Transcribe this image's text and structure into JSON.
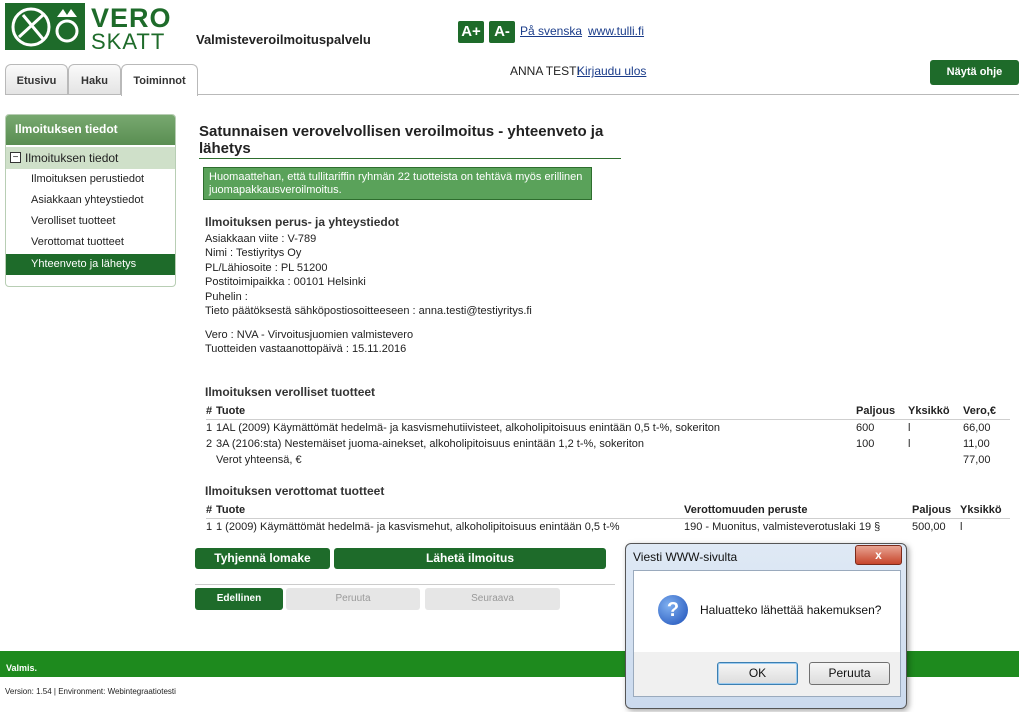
{
  "header": {
    "logo_text_1": "VERO",
    "logo_text_2": "SKATT",
    "service_title": "Valmisteveroilmoituspalvelu",
    "font_larger": "A+",
    "font_smaller": "A-",
    "language_link": "På svenska",
    "tulli_link": "www.tulli.fi",
    "user_name": "ANNA TESTI",
    "logout_link": "Kirjaudu ulos",
    "help_button": "Näytä ohje"
  },
  "tabs": [
    {
      "label": "Etusivu"
    },
    {
      "label": "Haku"
    },
    {
      "label": "Toiminnot"
    }
  ],
  "sidebar": {
    "heading": "Ilmoituksen tiedot",
    "section": "Ilmoituksen tiedot",
    "items": [
      {
        "label": "Ilmoituksen perustiedot"
      },
      {
        "label": "Asiakkaan yhteystiedot"
      },
      {
        "label": "Verolliset tuotteet"
      },
      {
        "label": "Verottomat tuotteet"
      },
      {
        "label": "Yhteenveto ja lähetys"
      }
    ]
  },
  "main": {
    "title": "Satunnaisen verovelvollisen veroilmoitus - yhteenveto ja lähetys",
    "notice": "Huomaattehan, että tullitariffin ryhmän 22 tuotteista on tehtävä myös erillinen juomapakkausveroilmoitus.",
    "basic_section_title": "Ilmoituksen perus- ja yhteystiedot",
    "basic_lines": [
      "Asiakkaan viite : V-789",
      "Nimi : Testiyritys Oy",
      "PL/Lähiosoite : PL 51200",
      "Postitoimipaikka : 00101 Helsinki",
      "Puhelin :",
      "Tieto päätöksestä sähköpostiosoitteeseen : anna.testi@testiyritys.fi"
    ],
    "vero_lines": [
      "Vero : NVA - Virvoitusjuomien valmistevero",
      "Tuotteiden vastaanottopäivä : 15.11.2016"
    ],
    "taxable": {
      "title": "Ilmoituksen verolliset tuotteet",
      "headers": [
        "#",
        "Tuote",
        "Paljous",
        "Yksikkö",
        "Vero,€"
      ],
      "rows": [
        [
          "1",
          "1AL (2009) Käymättömät hedelmä- ja kasvismehutiivisteet, alkoholipitoisuus enintään 0,5 t-%, sokeriton",
          "600",
          "l",
          "66,00"
        ],
        [
          "2",
          "3A (2106:sta) Nestemäiset juoma-ainekset, alkoholipitoisuus enintään 1,2 t-%, sokeriton",
          "100",
          "l",
          "11,00"
        ]
      ],
      "total_label": "Verot yhteensä, €",
      "total_value": "77,00"
    },
    "exempt": {
      "title": "Ilmoituksen verottomat tuotteet",
      "headers": [
        "#",
        "Tuote",
        "Verottomuuden peruste",
        "Paljous",
        "Yksikkö"
      ],
      "rows": [
        [
          "1",
          "1 (2009) Käymättömät hedelmä- ja kasvismehut, alkoholipitoisuus enintään 0,5 t-%",
          "190 - Muonitus, valmisteverotuslaki 19 §",
          "500,00",
          "l"
        ]
      ]
    },
    "buttons": {
      "clear": "Tyhjennä lomake",
      "send": "Lähetä ilmoitus",
      "prev": "Edellinen",
      "cancel": "Peruuta",
      "next": "Seuraava"
    }
  },
  "footer": {
    "text": "Valmis.",
    "version": "Version: 1.54 | Environment: Webintegraatiotesti"
  },
  "dialog": {
    "title": "Viesti WWW-sivulta",
    "close": "x",
    "icon_glyph": "?",
    "message": "Haluatteko lähettää hakemuksen?",
    "ok": "OK",
    "cancel": "Peruuta"
  }
}
